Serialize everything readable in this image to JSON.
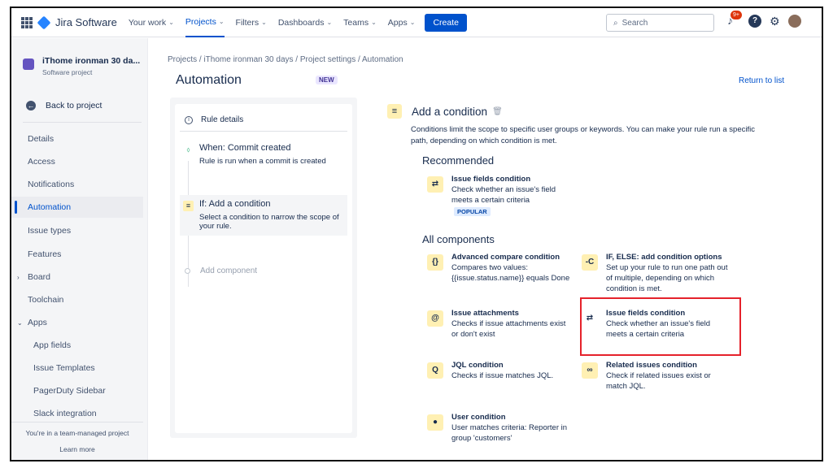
{
  "topnav": {
    "product": "Jira Software",
    "items": [
      {
        "label": "Your work"
      },
      {
        "label": "Projects"
      },
      {
        "label": "Filters"
      },
      {
        "label": "Dashboards"
      },
      {
        "label": "Teams"
      },
      {
        "label": "Apps"
      }
    ],
    "create": "Create",
    "search_placeholder": "Search",
    "notif_badge": "9+",
    "help": "?"
  },
  "sidebar": {
    "project_name": "iThome ironman 30 da...",
    "project_type": "Software project",
    "back": "Back to project",
    "items": [
      {
        "label": "Details"
      },
      {
        "label": "Access"
      },
      {
        "label": "Notifications"
      },
      {
        "label": "Automation"
      },
      {
        "label": "Issue types"
      },
      {
        "label": "Features"
      },
      {
        "label": "Board"
      },
      {
        "label": "Toolchain"
      },
      {
        "label": "Apps"
      },
      {
        "label": "App fields"
      },
      {
        "label": "Issue Templates"
      },
      {
        "label": "PagerDuty Sidebar"
      },
      {
        "label": "Slack integration"
      }
    ],
    "footer_text": "You're in a team-managed project",
    "footer_link": "Learn more"
  },
  "main": {
    "breadcrumb": "Projects  /  iThome ironman 30 days  /  Project settings  /  Automation",
    "title": "Automation",
    "new_lozenge": "NEW",
    "return_link": "Return to list"
  },
  "rule": {
    "details": "Rule details",
    "when_title": "When: Commit created",
    "when_desc": "Rule is run when a commit is created",
    "if_title": "If: Add a condition",
    "if_desc": "Select a condition to narrow the scope of your rule.",
    "add_component": "Add component"
  },
  "condition": {
    "title": "Add a condition",
    "description": "Conditions limit the scope to specific user groups or keywords. You can make your rule run a specific path, depending on which condition is met.",
    "recommended_heading": "Recommended",
    "all_heading": "All components",
    "recommended": {
      "title": "Issue fields condition",
      "desc": "Check whether an issue's field meets a certain criteria",
      "badge": "POPULAR"
    },
    "components": [
      {
        "title": "Advanced compare condition",
        "desc": "Compares two values: {{issue.status.name}} equals Done",
        "icon": "{}"
      },
      {
        "title": "IF, ELSE: add condition options",
        "desc": "Set up your rule to run one path out of multiple, depending on which condition is met.",
        "icon": "-C"
      },
      {
        "title": "Issue attachments",
        "desc": "Checks if issue attachments exist or don't exist",
        "icon": "@"
      },
      {
        "title": "Issue fields condition",
        "desc": "Check whether an issue's field meets a certain criteria",
        "icon": "⇄"
      },
      {
        "title": "JQL condition",
        "desc": "Checks if issue matches JQL.",
        "icon": "Q"
      },
      {
        "title": "Related issues condition",
        "desc": "Check if related issues exist or match JQL.",
        "icon": "∞"
      },
      {
        "title": "User condition",
        "desc": "User matches criteria: Reporter in group 'customers'",
        "icon": "●"
      }
    ]
  },
  "colors": {
    "accent": "#0052cc",
    "highlight": "#e5222b",
    "condition_icon_bg": "#fff0b3"
  }
}
